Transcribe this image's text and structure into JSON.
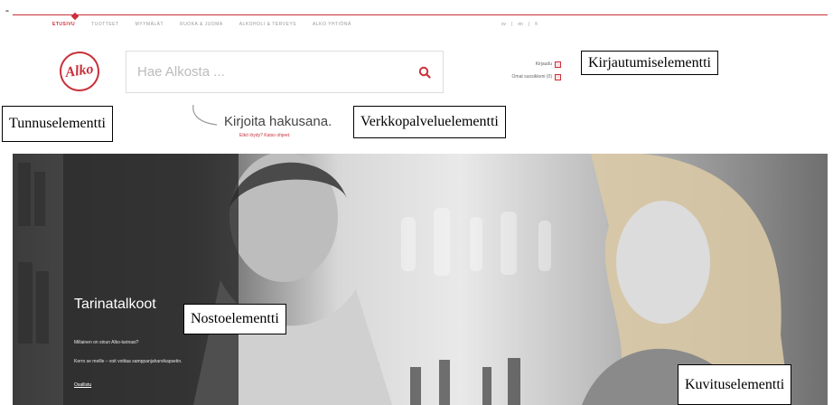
{
  "annotations": {
    "dash": "-",
    "login_element": "Kirjautumiselementti",
    "identity_element": "Tunnuselementti",
    "service_element": "Verkkopalveluelementti",
    "highlight_element": "Nostoelementti",
    "illustration_element": "Kuvituselementti"
  },
  "nav": {
    "items": [
      {
        "label": "ETUSIVU",
        "active": true
      },
      {
        "label": "TUOTTEET",
        "active": false
      },
      {
        "label": "MYYMÄLÄT",
        "active": false
      },
      {
        "label": "RUOKA & JUOMA",
        "active": false
      },
      {
        "label": "ALKOHOLI & TERVEYS",
        "active": false
      },
      {
        "label": "ALKO YHTIÖNÄ",
        "active": false
      }
    ],
    "languages": [
      "sv",
      "|",
      "en",
      "|",
      "fi"
    ]
  },
  "logo": {
    "text": "Alko"
  },
  "search": {
    "placeholder": "Hae Alkosta ..."
  },
  "login": {
    "login_label": "Kirjaudu",
    "favorites_label": "Omat suosikkeni (0)"
  },
  "hint": {
    "title": "Kirjoita hakusana.",
    "subtitle": "Etkö löydy? Katso ohjeet."
  },
  "promo": {
    "title": "Tarinatalkoot",
    "question": "Millainen on sinun Alko-tarinasi?",
    "body": "Kerro se meille – voit voittaa samppanjaharvikapsetin.",
    "link": "Osallistu"
  },
  "colors": {
    "accent": "#c9303a"
  },
  "icons": {
    "search": "magnifier-icon",
    "login": "square-icon",
    "favorites": "square-icon"
  }
}
